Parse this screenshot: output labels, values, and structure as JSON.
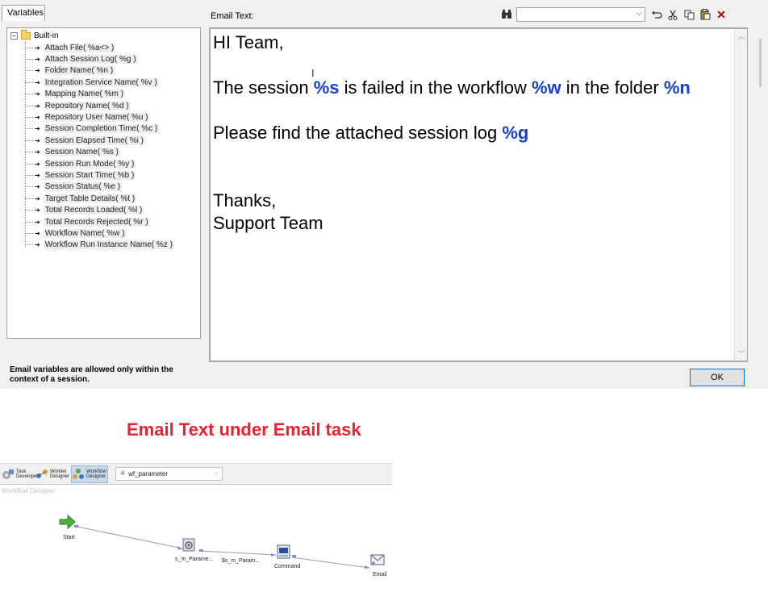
{
  "dialog": {
    "variables_tab": "Variables",
    "tree_root": "Built-in",
    "variables": [
      "Attach File( %a<> )",
      "Attach Session Log( %g )",
      "Folder Name( %n )",
      "Integration Service Name( %v )",
      "Mapping Name( %m )",
      "Repository Name( %d )",
      "Repository User Name( %u )",
      "Session Completion Time( %c )",
      "Session Elapsed Time( %i )",
      "Session Name( %s )",
      "Session Run Mode( %y )",
      "Session Start Time( %b )",
      "Session Status( %e )",
      "Target Table Details( %t )",
      "Total Records Loaded( %l )",
      "Total Records Rejected( %r )",
      "Workflow Name( %w )",
      "Workflow Run Instance Name( %z )"
    ],
    "note": "Email variables are allowed only within the context of a session.",
    "email_text_label": "Email Text:",
    "find_value": "",
    "ok_label": "OK",
    "editor": {
      "greeting": "HI Team,",
      "line1_a": "The session ",
      "var_s": "%s",
      "line1_b": " is failed in the workflow ",
      "var_w": "%w",
      "line1_c": " in the folder ",
      "var_n": "%n",
      "line2_a": "Please find the attached session log ",
      "var_g": "%g",
      "thanks": "Thanks,",
      "signature": "Support Team"
    },
    "toolbar_icons": [
      "find-binoculars-icon",
      "undo-icon",
      "cut-icon",
      "copy-icon",
      "paste-icon",
      "close-icon"
    ]
  },
  "caption": "Email Text under Email task",
  "workflow": {
    "tabs": [
      {
        "line1": "Task",
        "line2": "Developer"
      },
      {
        "line1": "Worklet",
        "line2": "Designer"
      },
      {
        "line1": "Workflow",
        "line2": "Designer"
      }
    ],
    "workflow_select": "wf_parameter",
    "panel_title": "Workflow Designer",
    "nodes": {
      "start": "Start",
      "session1": "s_m_Parame...",
      "session2": "$s_m_Param...",
      "command": "Command",
      "email": "Email"
    }
  },
  "colors": {
    "variable_highlight": "#1a3fc8",
    "caption": "#e8222e",
    "close_icon": "#c00000"
  }
}
